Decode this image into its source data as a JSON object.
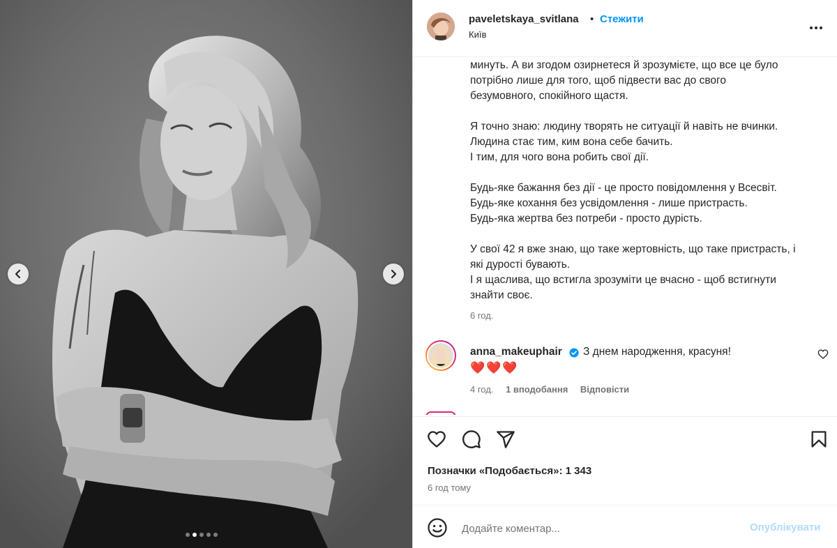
{
  "post": {
    "username": "paveletskaya_svitlana",
    "separator": "•",
    "follow_label": "Стежити",
    "location": "Київ"
  },
  "caption": {
    "lines": [
      "минуть. А ви згодом озирнетеся й зрозумієте, що все це було",
      "потрібно лише для того, щоб підвести вас до свого",
      "безумовного, спокійного щастя.",
      "",
      "Я точно знаю: людину творять не ситуації й навіть не вчинки.",
      "Людина стає тим, ким вона себе бачить.",
      "І тим, для чого вона робить свої дії.",
      "",
      "Будь-яке бажання без дії - це просто повідомлення у Всесвіт.",
      "Будь-яке кохання без усвідомлення - лише пристрасть.",
      "Будь-яка жертва без потреби - просто дурість.",
      "",
      "У свої 42 я вже знаю, що таке жертовність, що таке пристрасть, і",
      "які дурості бувають.",
      "І я щаслива, що встигла зрозуміти це вчасно - щоб встигнути",
      "знайти своє."
    ],
    "time": "6 год."
  },
  "comment": {
    "username": "anna_makeuphair",
    "text": "З днем народження, красуня!",
    "hearts": "❤️❤️❤️",
    "time": "4 год.",
    "likes": "1 вподобання",
    "reply": "Відповісти"
  },
  "actions": {
    "likes_text": "Позначки «Подобається»: 1 343",
    "date": "6 год тому"
  },
  "add_comment": {
    "placeholder": "Додайте коментар...",
    "publish_label": "Опублікувати"
  },
  "carousel": {
    "slide_count": 5,
    "active_index": 1
  },
  "icons": {
    "prev": "chevron-left-icon",
    "next": "chevron-right-icon",
    "more": "more-horizontal-icon",
    "verified": "verified-badge-icon",
    "like": "heart-icon",
    "comment": "comment-icon",
    "share": "send-icon",
    "save": "bookmark-icon",
    "emoji": "emoji-icon"
  },
  "colors": {
    "link": "#0095f6",
    "text": "#262626",
    "muted": "#737373",
    "publish_disabled": "#b3dbff",
    "heart": "#e0245e"
  }
}
